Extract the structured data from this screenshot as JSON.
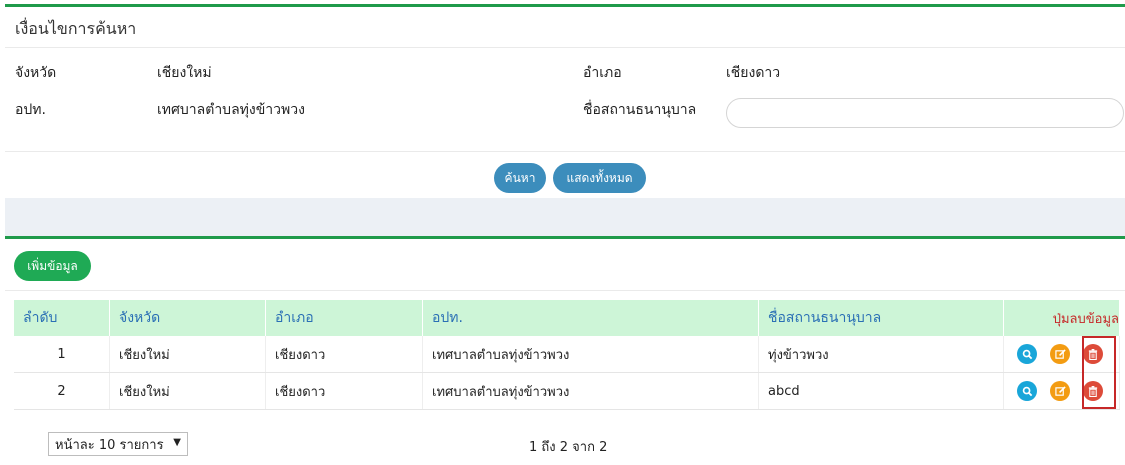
{
  "search_panel": {
    "title": "เงื่อนไขการค้นหา",
    "province_label": "จังหวัด",
    "province_value": "เชียงใหม่",
    "district_label": "อำเภอ",
    "district_value": "เชียงดาว",
    "lao_label": "อปท.",
    "lao_value": "เทศบาลตำบลทุ่งข้าวพวง",
    "nursery_label": "ชื่อสถานธนานุบาล",
    "nursery_value": "",
    "search_button": "ค้นหา",
    "show_all_button": "แสดงทั้งหมด"
  },
  "list_panel": {
    "add_button": "เพิ่มข้อมูล",
    "columns": [
      "ลำดับ",
      "จังหวัด",
      "อำเภอ",
      "อปท.",
      "ชื่อสถานธนานุบาล",
      "ปุ่มลบข้อมูล"
    ],
    "rows": [
      {
        "no": "1",
        "province": "เชียงใหม่",
        "district": "เชียงดาว",
        "lao": "เทศบาลตำบลทุ่งข้าวพวง",
        "name": "ทุ่งข้าวพวง"
      },
      {
        "no": "2",
        "province": "เชียงใหม่",
        "district": "เชียงดาว",
        "lao": "เทศบาลตำบลทุ่งข้าวพวง",
        "name": "abcd"
      }
    ],
    "action_icons": [
      "search-icon",
      "edit-icon",
      "trash-icon"
    ],
    "page_size": "หน้าละ 10 รายการ",
    "page_info": "1 ถึง 2 จาก 2"
  },
  "colors": {
    "green_border": "#1f9a4a",
    "header_bg": "#cdf5d7",
    "header_text": "#2a6fb5",
    "btn_blue": "#3c8dbc",
    "btn_green": "#1faa55",
    "highlight_red": "#c62828"
  }
}
